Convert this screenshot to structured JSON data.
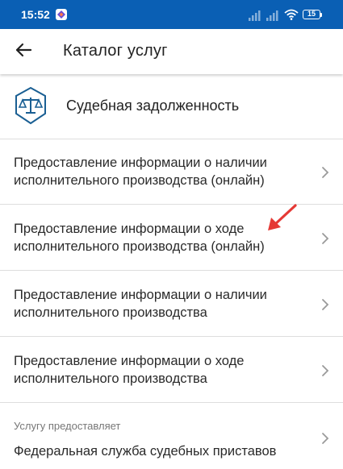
{
  "status_bar": {
    "time": "15:52",
    "battery": "15",
    "icons": [
      "app-badge-icon",
      "signal-icon",
      "signal-icon",
      "wifi-icon",
      "battery-icon"
    ]
  },
  "header": {
    "back_icon": "arrow-left-icon",
    "title": "Каталог услуг"
  },
  "category": {
    "icon": "scales-icon",
    "title": "Судебная задолженность",
    "accent_color": "#1a5f93"
  },
  "services": [
    {
      "line1": "Предоставление информации о наличии",
      "line2": "исполнительного производства (онлайн)"
    },
    {
      "line1": "Предоставление информации о ходе",
      "line2": "исполнительного производства (онлайн)"
    },
    {
      "line1": "Предоставление информации о наличии",
      "line2": "исполнительного производства"
    },
    {
      "line1": "Предоставление информации о ходе",
      "line2": "исполнительного производства"
    }
  ],
  "provider": {
    "label": "Услугу предоставляет",
    "name": "Федеральная служба судебных приставов"
  },
  "colors": {
    "status_bar": "#0a5fb4",
    "annotation_arrow": "#e53935"
  }
}
